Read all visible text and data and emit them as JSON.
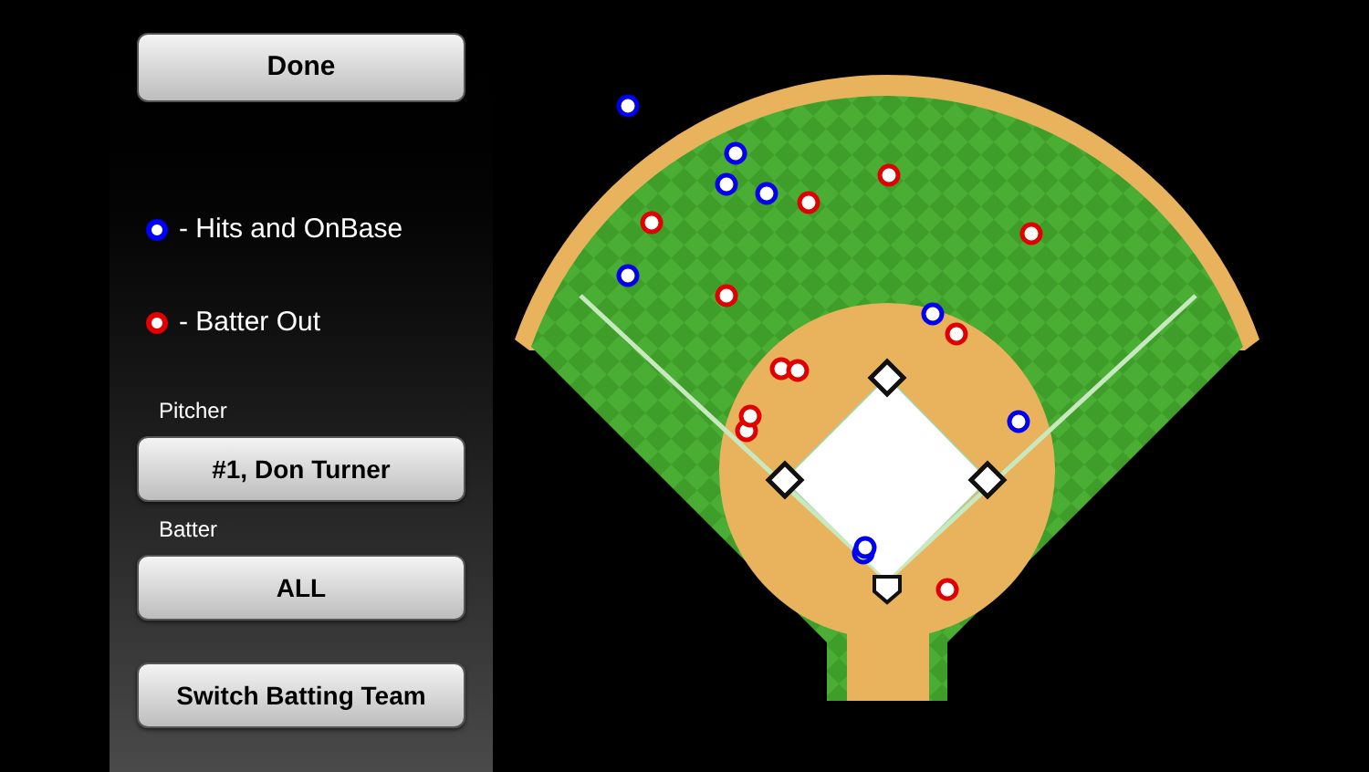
{
  "done_button": "Done",
  "legend": [
    {
      "label": "- Hits and OnBase",
      "color": "#0000ff"
    },
    {
      "label": "- Batter Out",
      "color": "#e00000"
    }
  ],
  "pitcher": {
    "label": "Pitcher",
    "value": "#1, Don Turner"
  },
  "batter": {
    "label": "Batter",
    "value": "ALL"
  },
  "switch_button": "Switch Batting Team"
}
